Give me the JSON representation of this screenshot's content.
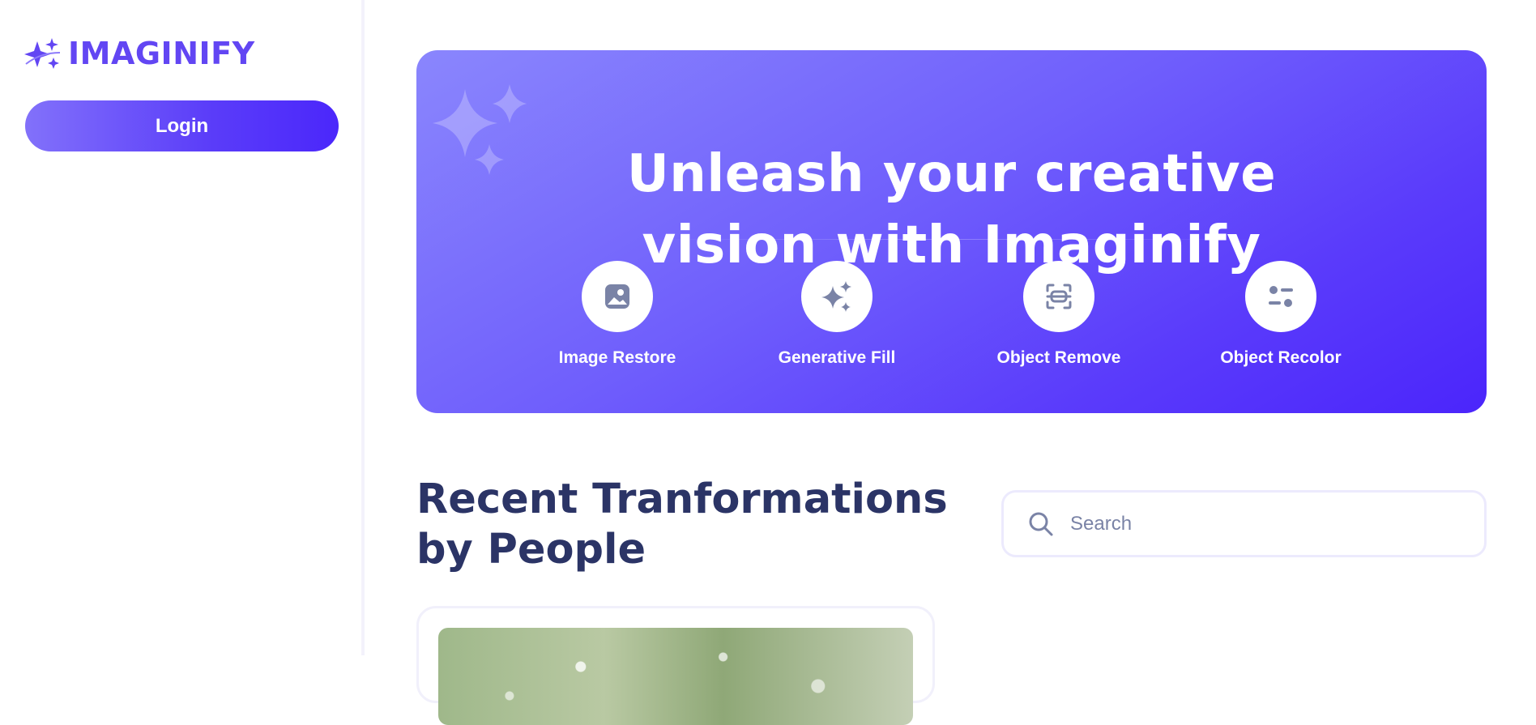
{
  "app": {
    "name": "IMAGINIFY"
  },
  "sidebar": {
    "login_label": "Login"
  },
  "hero": {
    "title_line1": "Unleash your creative",
    "title_line2": "vision with Imaginify",
    "features": [
      {
        "label": "Image Restore",
        "icon": "image-icon"
      },
      {
        "label": "Generative Fill",
        "icon": "sparkles-icon"
      },
      {
        "label": "Object Remove",
        "icon": "scan-icon"
      },
      {
        "label": "Object Recolor",
        "icon": "filter-icon"
      }
    ]
  },
  "recent": {
    "title": "Recent Tranformations by People",
    "search_placeholder": "Search"
  },
  "colors": {
    "brand": "#6246f3",
    "heading": "#2b3466",
    "icon_gray": "#7a83a6"
  }
}
